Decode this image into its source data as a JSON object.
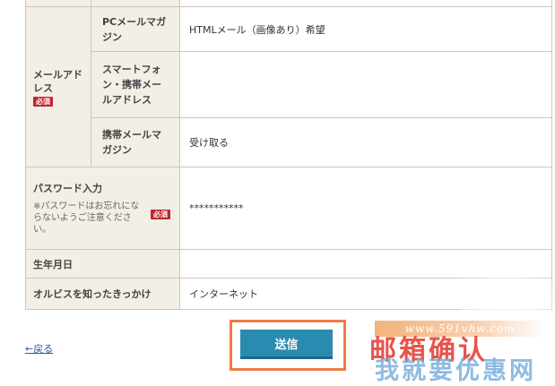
{
  "form": {
    "email_label": "メールアドレス",
    "required_badge": "必須",
    "pc_magazine_label": "PCメールマガジン",
    "pc_magazine_value": "HTMLメール（画像あり）希望",
    "mobile_address_label": "スマートフォン・携帯メールアドレス",
    "mobile_address_value": "",
    "mobile_magazine_label": "携帯メールマガジン",
    "mobile_magazine_value": "受け取る",
    "password_label": "パスワード入力",
    "password_note": "※パスワードはお忘れにならないようご注意ください。",
    "password_value": "***********",
    "birthday_label": "生年月日",
    "birthday_value": "",
    "referral_label": "オルビスを知ったきっかけ",
    "referral_value": "インターネット"
  },
  "actions": {
    "back_label": "←戻る",
    "submit_label": "送信"
  },
  "watermark": {
    "url": "www.591vhw.com",
    "line1": "邮箱确认",
    "line2": "我就要优惠网"
  },
  "colors": {
    "label_bg": "#f3eee6",
    "border": "#cfc6ba",
    "required_red": "#c0272d",
    "submit_blue": "#2b8ab0",
    "highlight_orange": "#ec7b4a",
    "link_blue": "#2b5a99"
  }
}
